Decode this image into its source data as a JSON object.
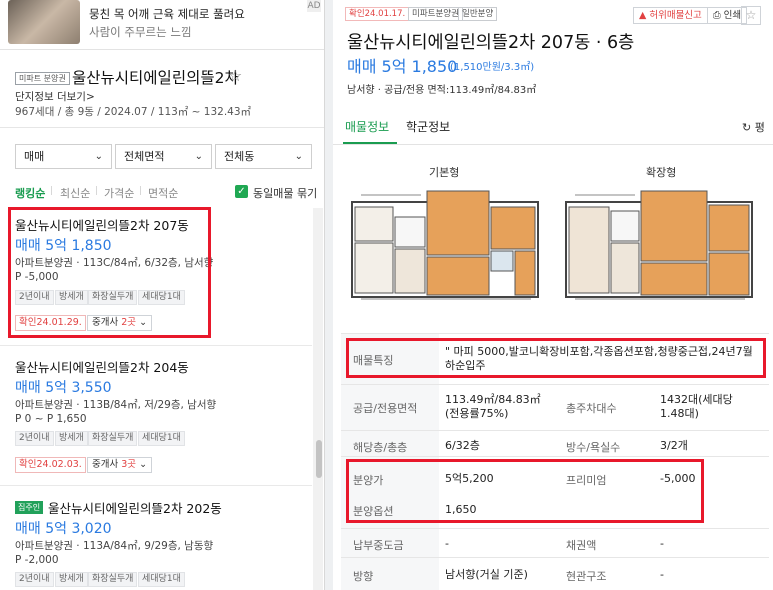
{
  "ad": {
    "title": "뭉친 목 어깨 근육 제대로 풀려요",
    "subtitle": "사람이 주무르는 느낌",
    "close_label": "AD"
  },
  "complex": {
    "badge": "미파트 분양권",
    "name": "울산뉴시티에일린의뜰2차",
    "link": "단지정보 더보기>",
    "meta": "967세대 / 총 9동 / 2024.07 / 113㎡ ~ 132.43㎡"
  },
  "filters": {
    "deal_type": "매매",
    "area": "전체면적",
    "building": "전체동"
  },
  "sort": {
    "options": [
      "랭킹순",
      "최신순",
      "가격순",
      "면적순"
    ],
    "same_listing_label": "동일매물 묶기"
  },
  "listings": [
    {
      "title": "울산뉴시티에일린의뜰2차 207동",
      "price": "매매 5억 1,850",
      "info": "아파트분양권 · 113C/84㎡, 6/32층, 남서향",
      "premium": "P -5,000",
      "tags": [
        "2년이내",
        "방세개",
        "화장실두개",
        "세대당1대"
      ],
      "confirm": "확인24.01.29.",
      "agent_prefix": "중개사",
      "agent_count": "2곳"
    },
    {
      "title": "울산뉴시티에일린의뜰2차 204동",
      "price": "매매 5억 3,550",
      "info": "아파트분양권 · 113B/84㎡, 저/29층, 남서향",
      "premium": "P 0 ~ P 1,650",
      "tags": [
        "2년이내",
        "방세개",
        "화장실두개",
        "세대당1대"
      ],
      "confirm": "확인24.02.03.",
      "agent_prefix": "중개사",
      "agent_count": "3곳"
    },
    {
      "badge": "집주인",
      "title": "울산뉴시티에일린의뜰2차 202동",
      "price": "매매 5억 3,020",
      "info": "아파트분양권 · 113A/84㎡, 9/29층, 남동향",
      "premium": "P -2,000",
      "tags": [
        "2년이내",
        "방세개",
        "화장실두개",
        "세대당1대"
      ]
    }
  ],
  "detail": {
    "badges": [
      "확인24.01.17.",
      "미파트분양권",
      "일반분양"
    ],
    "report_label": "허위매물신고",
    "print_label": "인쇄",
    "title": "울산뉴시티에일린의뜰2차 207동 · 6층",
    "price": "매매 5억 1,850",
    "price_sub": "(1,510만원/3.3㎡)",
    "meta": "남서향 · 공급/전용 면적:113.49㎡/84.83㎡",
    "tabs": [
      "매물정보",
      "학군정보"
    ],
    "refresh_label": "평",
    "plan_labels": [
      "기본형",
      "확장형"
    ],
    "rows": {
      "feature_label": "매물특징",
      "feature_value": "\" 마피 5000,발코니확장비포함,각종옵션포함,청량중근접,24년7월하순입주",
      "area_label": "공급/전용면적",
      "area_value": "113.49㎡/84.83㎡(전용률75%)",
      "households_label": "총주차대수",
      "households_value": "1432대(세대당 1.48대)",
      "floor_label": "해당층/총층",
      "floor_value": "6/32층",
      "rooms_label": "방수/욕실수",
      "rooms_value": "3/2개",
      "sale_price_label": "분양가",
      "sale_price_value": "5억5,200",
      "premium_label": "프리미엄",
      "premium_value": "-5,000",
      "option_label": "분양옵션",
      "option_value": "1,650",
      "paid_label": "납부중도금",
      "paid_value": "-",
      "loan_label": "채권액",
      "loan_value": "-",
      "direction_label": "방향",
      "direction_value": "남서향(거실 기준)",
      "entrance_label": "현관구조",
      "entrance_value": "-"
    }
  },
  "colors": {
    "accent_green": "#1a9c50",
    "price_blue": "#2a7ae0",
    "highlight_red": "#e8182b"
  }
}
